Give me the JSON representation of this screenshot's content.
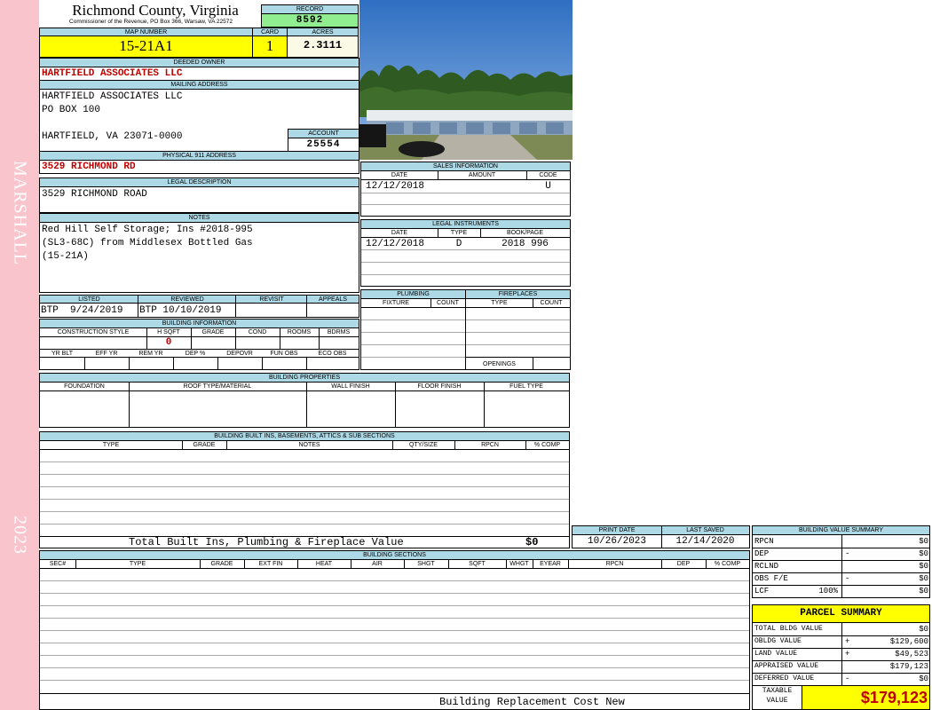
{
  "side": {
    "marshall": "MARSHALL",
    "year": "2023"
  },
  "header": {
    "county": "Richmond County, Virginia",
    "commissioner": "Commissioner of the Revenue, PO Box 366, Warsaw, VA 22572",
    "record_label": "RECORD",
    "record": "8592",
    "map_label": "MAP NUMBER",
    "map_number": "15-21A1",
    "card_label": "CARD",
    "card": "1",
    "acres_label": "ACRES",
    "acres": "2.3111"
  },
  "owner": {
    "label": "DEEDED OWNER",
    "name": "HARTFIELD ASSOCIATES LLC"
  },
  "mailing": {
    "label": "MAILING ADDRESS",
    "line1": "HARTFIELD ASSOCIATES LLC",
    "line2": "PO BOX 100",
    "line3": "HARTFIELD, VA 23071-0000"
  },
  "account": {
    "label": "ACCOUNT",
    "value": "25554"
  },
  "physical": {
    "label": "PHYSICAL 911 ADDRESS",
    "value": "3529 RICHMOND RD"
  },
  "legal": {
    "label": "LEGAL DESCRIPTION",
    "value": "3529 RICHMOND ROAD"
  },
  "notes": {
    "label": "NOTES",
    "line1": "Red Hill Self Storage; Ins #2018-995",
    "line2": "(SL3-68C) from Middlesex Bottled Gas",
    "line3": "(15-21A)"
  },
  "listed": {
    "listed_label": "LISTED",
    "reviewed_label": "REVIEWED",
    "revisit_label": "REVISIT",
    "appeals_label": "APPEALS",
    "listed": "BTP  9/24/2019",
    "reviewed": "BTP 10/10/2019"
  },
  "bldg_info": {
    "label": "BUILDING INFORMATION",
    "cols1": [
      "CONSTRUCTION STYLE",
      "H SQFT",
      "GRADE",
      "COND",
      "ROOMS",
      "BDRMS"
    ],
    "hsqft": "0",
    "cols2": [
      "YR BLT",
      "EFF YR",
      "REM YR",
      "DEP %",
      "DEPOVR",
      "FUN OBS",
      "ECO OBS"
    ]
  },
  "sales": {
    "label": "SALES INFORMATION",
    "cols": [
      "DATE",
      "AMOUNT",
      "CODE"
    ],
    "date": "12/12/2018",
    "code": "U"
  },
  "instruments": {
    "label": "LEGAL INSTRUMENTS",
    "cols": [
      "DATE",
      "TYPE",
      "BOOK/PAGE"
    ],
    "date": "12/12/2018",
    "type": "D",
    "bookpage": "2018 996"
  },
  "plumbing": {
    "label": "PLUMBING",
    "fixture": "FIXTURE",
    "count": "COUNT"
  },
  "fireplaces": {
    "label": "FIREPLACES",
    "type": "TYPE",
    "count": "COUNT",
    "openings": "OPENINGS"
  },
  "props": {
    "label": "BUILDING PROPERTIES",
    "cols": [
      "FOUNDATION",
      "ROOF TYPE/MATERIAL",
      "WALL FINISH",
      "FLOOR FINISH",
      "FUEL TYPE"
    ]
  },
  "builtins": {
    "label": "BUILDING BUILT INS, BASEMENTS, ATTICS & SUB SECTIONS",
    "cols": [
      "TYPE",
      "GRADE",
      "NOTES",
      "QTY/SIZE",
      "RPCN",
      "% COMP"
    ],
    "total_label": "Total Built Ins, Plumbing & Fireplace Value",
    "total": "$0"
  },
  "dates": {
    "print_label": "PRINT DATE",
    "print": "10/26/2023",
    "saved_label": "LAST SAVED",
    "saved": "12/14/2020"
  },
  "sections": {
    "label": "BUILDING SECTIONS",
    "cols": [
      "SEC#",
      "TYPE",
      "GRADE",
      "EXT FIN",
      "HEAT",
      "AIR",
      "SHGT",
      "SQFT",
      "WHGT",
      "EYEAR",
      "RPCN",
      "DEP",
      "% COMP"
    ],
    "footer": "Building Replacement Cost New"
  },
  "bvs": {
    "label": "BUILDING VALUE SUMMARY",
    "rows": [
      {
        "label": "RPCN",
        "sign": "",
        "value": "$0"
      },
      {
        "label": "DEP",
        "sign": "-",
        "value": "$0"
      },
      {
        "label": "RCLND",
        "sign": "",
        "value": "$0"
      },
      {
        "label": "OBS F/E",
        "sign": "-",
        "value": "$0"
      },
      {
        "label": "LCF",
        "sign": "",
        "pct": "100%",
        "value": "$0"
      }
    ]
  },
  "parcel": {
    "label": "PARCEL SUMMARY",
    "rows": [
      {
        "label": "TOTAL BLDG VALUE",
        "sign": "",
        "value": "$0"
      },
      {
        "label": "OBLDG VALUE",
        "sign": "+",
        "value": "$129,600"
      },
      {
        "label": "LAND VALUE",
        "sign": "+",
        "value": "$49,523"
      },
      {
        "label": "APPRAISED VALUE",
        "sign": "",
        "value": "$179,123"
      },
      {
        "label": "DEFERRED VALUE",
        "sign": "-",
        "value": "$0"
      }
    ],
    "taxable_label1": "TAXABLE",
    "taxable_label2": "VALUE",
    "taxable": "$179,123"
  },
  "colors": {
    "side": "#f9c4cc",
    "header": "#add8e6",
    "highlight": "#ffff00",
    "record": "#90ee90",
    "value_red": "#c00000"
  }
}
